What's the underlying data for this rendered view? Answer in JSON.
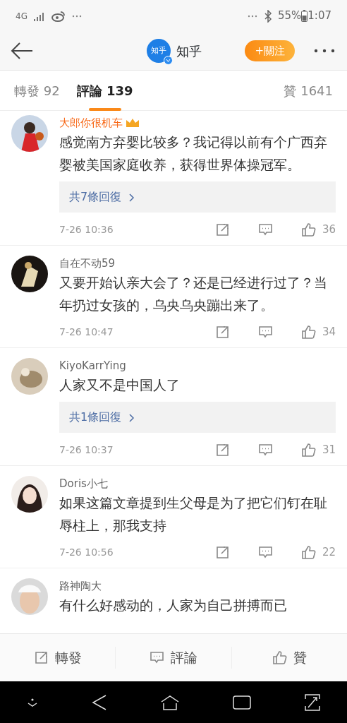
{
  "status_bar": {
    "network": "4G",
    "battery": "55%",
    "time": "1:07"
  },
  "header": {
    "logo_text": "知乎",
    "verified": true,
    "title": "知乎",
    "follow_button": "+關注"
  },
  "tabs": [
    {
      "label": "轉發 92",
      "selected": false
    },
    {
      "label": "評論 139",
      "selected": true
    },
    {
      "label": "贊 1641",
      "selected": false
    }
  ],
  "comments": [
    {
      "name": "大郎你很机车",
      "vip": true,
      "text": "感觉南方弃婴比较多？我记得以前有个广西弃婴被美国家庭收养，获得世界体操冠军。",
      "replies": "共7條回復",
      "time": "7-26 10:36",
      "likes": "36"
    },
    {
      "name": "自在不动59",
      "vip": false,
      "text": "又要开始认亲大会了？还是已经进行过了？当年扔过女孩的，乌央乌央蹦出来了。",
      "time": "7-26 10:47",
      "likes": "34"
    },
    {
      "name": "KiyoKarrYing",
      "vip": false,
      "text": "人家又不是中国人了",
      "replies": "共1條回復",
      "time": "7-26 10:37",
      "likes": "31"
    },
    {
      "name": "Doris小七",
      "vip": false,
      "text": "如果这篇文章提到生父母是为了把它们钉在耻辱柱上，那我支持",
      "time": "7-26 10:56",
      "likes": "22"
    },
    {
      "name": "路神陶大",
      "vip": false,
      "text": "有什么好感动的，人家为自己拼搏而已"
    }
  ],
  "actions": [
    {
      "kind": "share",
      "label": "轉發"
    },
    {
      "kind": "comment",
      "label": "評論"
    },
    {
      "kind": "like",
      "label": "贊"
    }
  ]
}
